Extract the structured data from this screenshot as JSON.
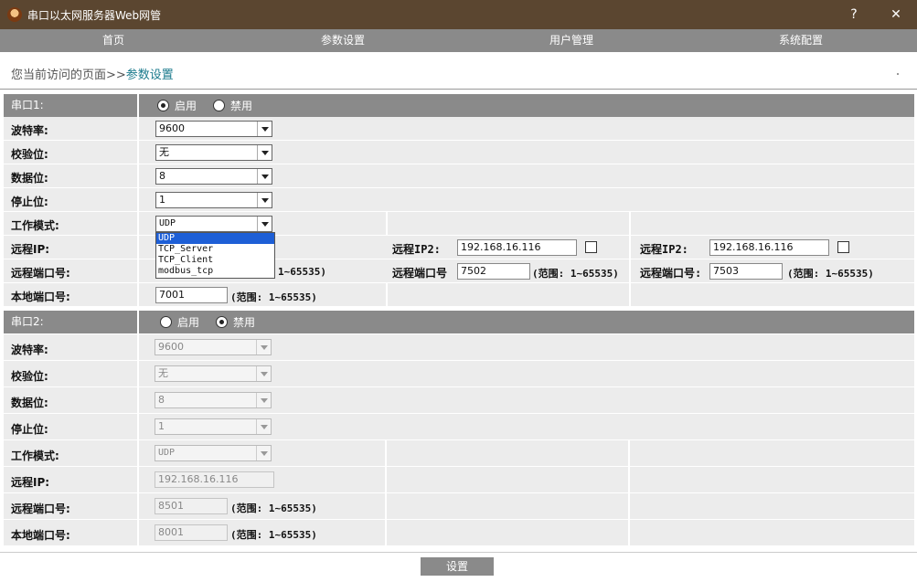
{
  "window": {
    "title": "串口以太网服务器Web网管",
    "help": "?",
    "close": "✕"
  },
  "nav": [
    "首页",
    "参数设置",
    "用户管理",
    "系统配置"
  ],
  "breadcrumb": {
    "prefix": "您当前访问的页面>>",
    "current": "参数设置"
  },
  "serial1": {
    "title": "串口1:",
    "enable_label": "启用",
    "disable_label": "禁用",
    "enabled": true,
    "baud_label": "波特率:",
    "baud": "9600",
    "parity_label": "校验位:",
    "parity": "无",
    "databits_label": "数据位:",
    "databits": "8",
    "stopbits_label": "停止位:",
    "stopbits": "1",
    "mode_label": "工作模式:",
    "mode": "UDP",
    "mode_options": [
      "UDP",
      "TCP_Server",
      "TCP_Client",
      "modbus_tcp"
    ],
    "remote_ip_label": "远程IP:",
    "remote_port_label": "远程端口号:",
    "local_port_label": "本地端口号:",
    "local_port": "7001",
    "range_text": "(范围: 1~65535)",
    "remote_port_range_visible": "1~65535)",
    "remote2_ip_label": "远程IP2:",
    "remote2_ip": "192.168.16.116",
    "remote2_port_label": "远程端口号",
    "remote2_port": "7502",
    "remote3_ip_label": "远程IP2:",
    "remote3_ip": "192.168.16.116",
    "remote3_port_label": "远程端口号:",
    "remote3_port": "7503"
  },
  "serial2": {
    "title": "串口2:",
    "enable_label": "启用",
    "disable_label": "禁用",
    "enabled": false,
    "baud_label": "波特率:",
    "baud": "9600",
    "parity_label": "校验位:",
    "parity": "无",
    "databits_label": "数据位:",
    "databits": "8",
    "stopbits_label": "停止位:",
    "stopbits": "1",
    "mode_label": "工作模式:",
    "mode": "UDP",
    "remote_ip_label": "远程IP:",
    "remote_ip": "192.168.16.116",
    "remote_port_label": "远程端口号:",
    "remote_port": "8501",
    "local_port_label": "本地端口号:",
    "local_port": "8001",
    "range_text": "(范围: 1~65535)"
  },
  "submit_label": "设置"
}
